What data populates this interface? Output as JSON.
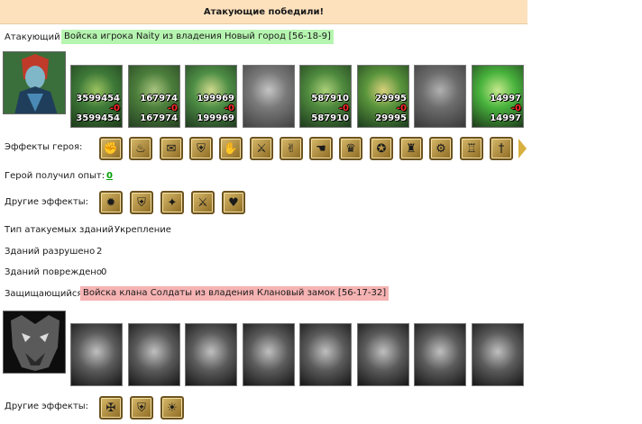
{
  "banner": {
    "title": "Атакующие победили!"
  },
  "attacker": {
    "label": "Атакующий",
    "army_title": "Войска игрока Naity из владения Новый город [56-18-9]",
    "units": [
      {
        "c1": "3599454",
        "c2": "-0",
        "c3": "3599454"
      },
      {
        "c1": "167974",
        "c2": "-0",
        "c3": "167974"
      },
      {
        "c1": "199969",
        "c2": "-0",
        "c3": "199969"
      },
      {
        "c1": "",
        "c2": "",
        "c3": ""
      },
      {
        "c1": "587910",
        "c2": "-0",
        "c3": "587910"
      },
      {
        "c1": "29995",
        "c2": "-0",
        "c3": "29995"
      },
      {
        "c1": "",
        "c2": "",
        "c3": ""
      },
      {
        "c1": "14997",
        "c2": "-0",
        "c3": "14997"
      }
    ],
    "hero_effects_label": "Эффекты героя:",
    "hero_effects_icons": [
      "fist-icon",
      "horn-icon",
      "scroll-icon",
      "shield-icon",
      "gauntlet-icon",
      "sword-icon",
      "handshake-icon",
      "hand-icon",
      "crown-icon",
      "star-seal-icon",
      "armor-icon",
      "chain-icon",
      "bracer-icon",
      "dagger-icon"
    ],
    "exp_label": "Герой получил опыт:",
    "exp_value": "0",
    "other_effects_label": "Другие эффекты:",
    "other_effects_icons": [
      "flame-icon",
      "fire-shield-icon",
      "sword-glow-icon",
      "blue-sword-icon",
      "heart-sword-icon"
    ],
    "buildings_type_label": "Тип атакуемых зданий",
    "buildings_type_value": "Укрепление",
    "destroyed_label": "Зданий разрушено",
    "destroyed_value": "2",
    "damaged_label": "Зданий повреждено",
    "damaged_value": "0"
  },
  "defender": {
    "label": "Защищающийся",
    "army_title": "Войска клана Солдаты из владения Клановый замок [56-17-32]",
    "other_effects_label": "Другие эффекты:",
    "other_effects_icons": [
      "rune-icon",
      "shield-icon",
      "hand-fire-icon"
    ]
  }
}
